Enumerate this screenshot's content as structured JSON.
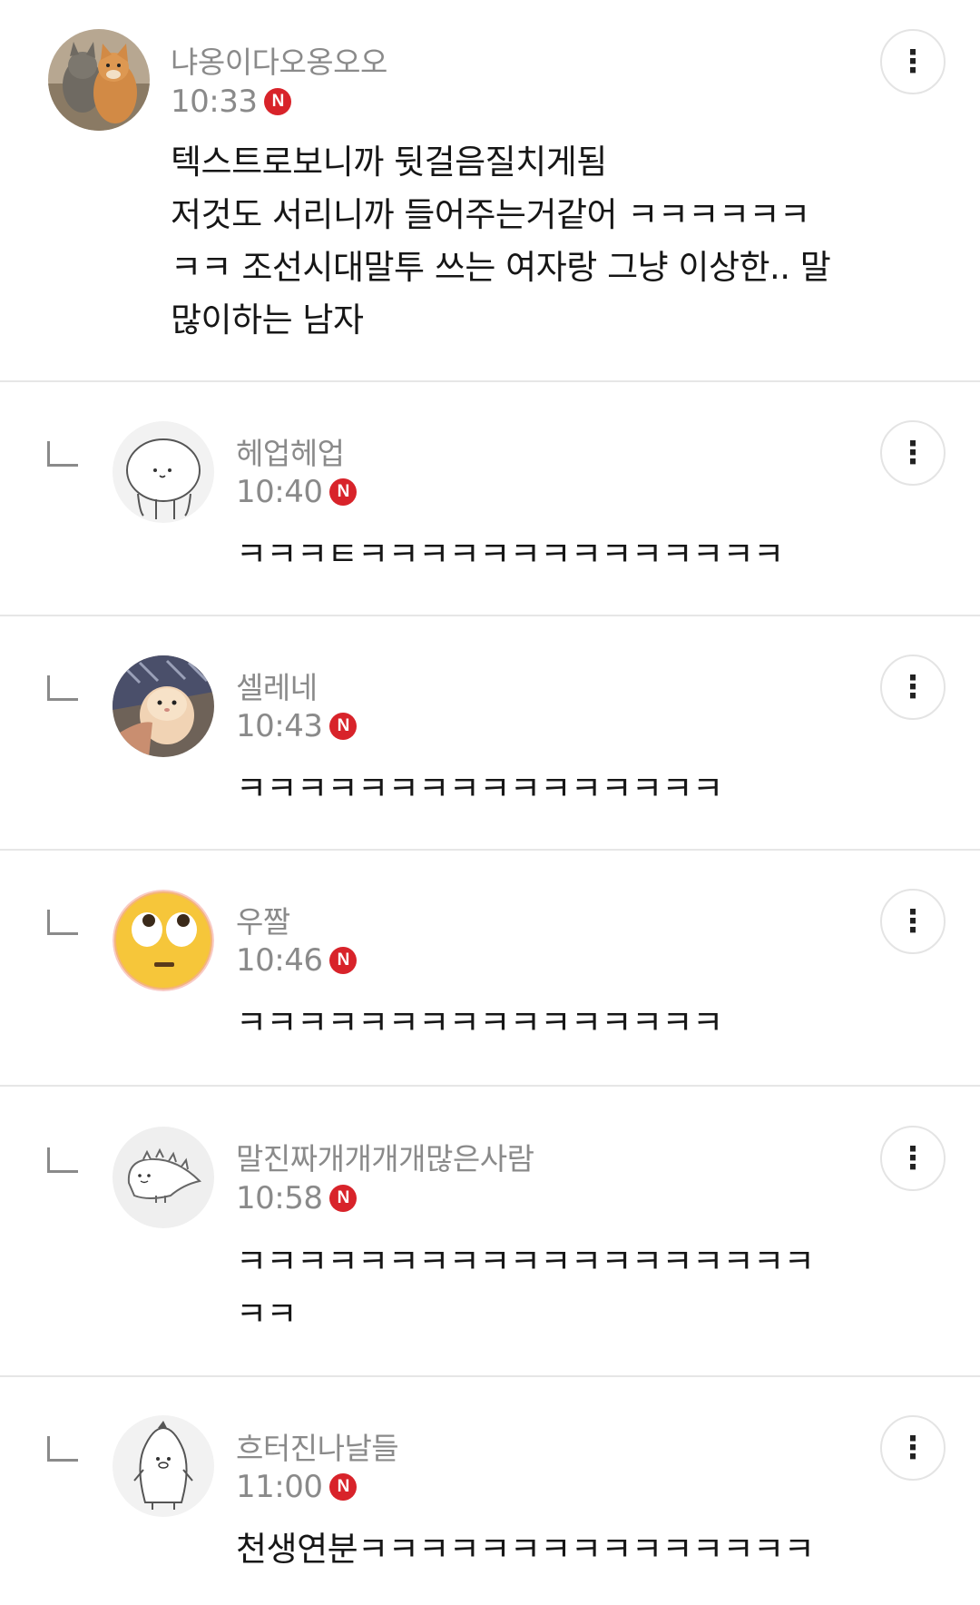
{
  "comments": [
    {
      "username": "냐옹이다오옹오오",
      "time": "10:33",
      "badge": "N",
      "text": "텍스트로보니까 뒷걸음질치게됨\n저것도 서리니까 들어주는거같어 ㅋㅋㅋㅋㅋㅋ\nㅋㅋ 조선시대말투 쓰는 여자랑 그냥 이상한.. 말\n많이하는 남자",
      "avatar_icon": "cats-photo-avatar",
      "reply": false
    },
    {
      "username": "헤업헤업",
      "time": "10:40",
      "badge": "N",
      "text": "ㅋㅋㅋㅌㅋㅋㅋㅋㅋㅋㅋㅋㅋㅋㅋㅋㅋㅋ",
      "avatar_icon": "blob-character-avatar",
      "reply": true
    },
    {
      "username": "셀레네",
      "time": "10:43",
      "badge": "N",
      "text": "ㅋㅋㅋㅋㅋㅋㅋㅋㅋㅋㅋㅋㅋㅋㅋㅋ",
      "avatar_icon": "hamster-photo-avatar",
      "reply": true
    },
    {
      "username": "우짤",
      "time": "10:46",
      "badge": "N",
      "text": "ㅋㅋㅋㅋㅋㅋㅋㅋㅋㅋㅋㅋㅋㅋㅋㅋ",
      "avatar_icon": "eye-roll-emoji-avatar",
      "reply": true
    },
    {
      "username": "말진짜개개개개많은사람",
      "time": "10:58",
      "badge": "N",
      "text": "ㅋㅋㅋㅋㅋㅋㅋㅋㅋㅋㅋㅋㅋㅋㅋㅋㅋㅋㅋ\nㅋㅋ",
      "avatar_icon": "dinosaur-character-avatar",
      "reply": true
    },
    {
      "username": "흐터진나날들",
      "time": "11:00",
      "badge": "N",
      "text": "천생연분ㅋㅋㅋㅋㅋㅋㅋㅋㅋㅋㅋㅋㅋㅋㅋ",
      "avatar_icon": "penguin-character-avatar",
      "reply": true
    }
  ],
  "icons": {
    "more": "more-vertical-icon",
    "reply": "reply-arrow-icon"
  },
  "colors": {
    "username": "#8a8a8a",
    "badge": "#d8232a",
    "divider": "#e6e6e6"
  }
}
